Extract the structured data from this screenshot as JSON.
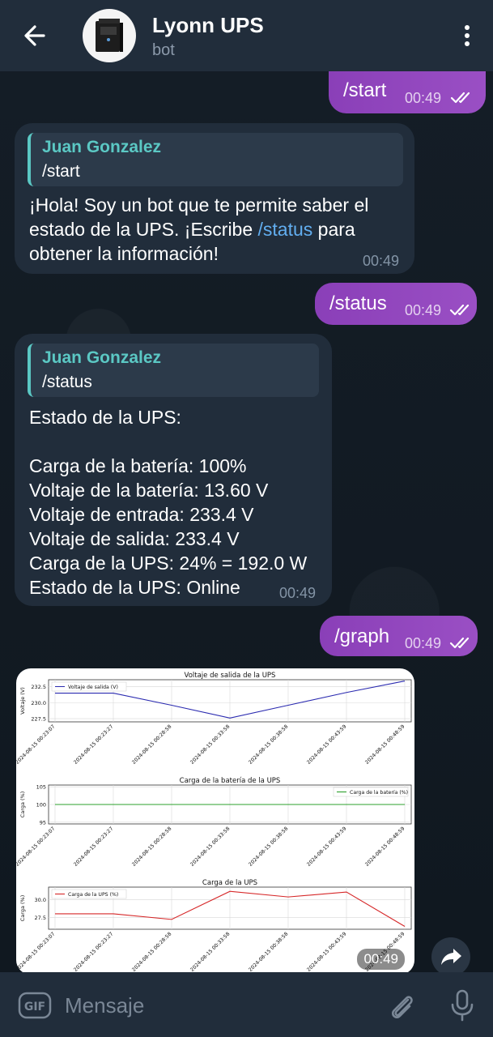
{
  "header": {
    "title": "Lyonn UPS",
    "subtitle": "bot"
  },
  "messages": [
    {
      "cmd": "/start",
      "time": "00:49"
    },
    {
      "reply_name": "Juan Gonzalez",
      "reply_text": "/start",
      "text_before": "¡Hola! Soy un bot que te permite saber el estado de la UPS. ¡Escribe ",
      "link": "/status",
      "text_after": " para obtener la información!",
      "time": "00:49"
    },
    {
      "cmd": "/status",
      "time": "00:49"
    },
    {
      "reply_name": "Juan Gonzalez",
      "reply_text": "/status",
      "lines": [
        "Estado de la UPS:",
        "",
        "Carga de la batería: 100%",
        "Voltaje de la batería: 13.60 V",
        "Voltaje de entrada: 233.4 V",
        "Voltaje de salida: 233.4 V",
        "Carga de la UPS: 24% = 192.0 W",
        "Estado de la UPS: Online"
      ],
      "time": "00:49"
    },
    {
      "cmd": "/graph",
      "time": "00:49"
    },
    {
      "photo_time": "00:49"
    }
  ],
  "input": {
    "placeholder": "Mensaje",
    "gif_label": "GIF"
  },
  "colors": {
    "outgoing": "#8e44ad",
    "incoming": "#212d3b",
    "accent_name": "#5bc8c4",
    "link": "#62aef0"
  },
  "chart_data": [
    {
      "type": "line",
      "title": "Voltaje de salida de la UPS",
      "ylabel": "Voltaje (V)",
      "x": [
        "2024-08-15 00:23:07",
        "2024-08-15 00:23:27",
        "2024-08-15 00:28:58",
        "2024-08-15 00:33:58",
        "2024-08-15 00:38:58",
        "2024-08-15 00:43:59",
        "2024-08-15 00:48:59"
      ],
      "series": [
        {
          "name": "Voltaje de salida (V)",
          "color": "#2b2bb0",
          "values": [
            231.5,
            231.5,
            229.6,
            227.6,
            229.6,
            231.6,
            233.4
          ]
        }
      ],
      "yticks": [
        "227.5",
        "230.0",
        "232.5"
      ],
      "ylim": [
        227,
        233.6
      ],
      "legend": "top-left",
      "grid": true
    },
    {
      "type": "line",
      "title": "Carga de la batería de la UPS",
      "ylabel": "Carga (%)",
      "x": [
        "2024-08-15 00:23:07",
        "2024-08-15 00:23:27",
        "2024-08-15 00:28:58",
        "2024-08-15 00:33:58",
        "2024-08-15 00:38:58",
        "2024-08-15 00:43:59",
        "2024-08-15 00:48:59"
      ],
      "series": [
        {
          "name": "Carga de la batería (%)",
          "color": "#2ca02c",
          "values": [
            100,
            100,
            100,
            100,
            100,
            100,
            100
          ]
        }
      ],
      "yticks": [
        "95",
        "100",
        "105"
      ],
      "ylim": [
        94.5,
        105.5
      ],
      "legend": "top-right",
      "grid": true
    },
    {
      "type": "line",
      "title": "Carga de la UPS",
      "ylabel": "Carga (%)",
      "x": [
        "2024-08-15 00:23:07",
        "2024-08-15 00:23:27",
        "2024-08-15 00:28:58",
        "2024-08-15 00:33:58",
        "2024-08-15 00:38:58",
        "2024-08-15 00:43:59",
        "2024-08-15 00:48:59"
      ],
      "series": [
        {
          "name": "Carga de la UPS (%)",
          "color": "#d62728",
          "values": [
            28,
            28,
            27.2,
            31.2,
            30.4,
            31.1,
            26.2
          ]
        }
      ],
      "yticks": [
        "27.5",
        "30.0"
      ],
      "ylim": [
        25.8,
        31.8
      ],
      "legend": "top-left",
      "grid": true
    }
  ]
}
